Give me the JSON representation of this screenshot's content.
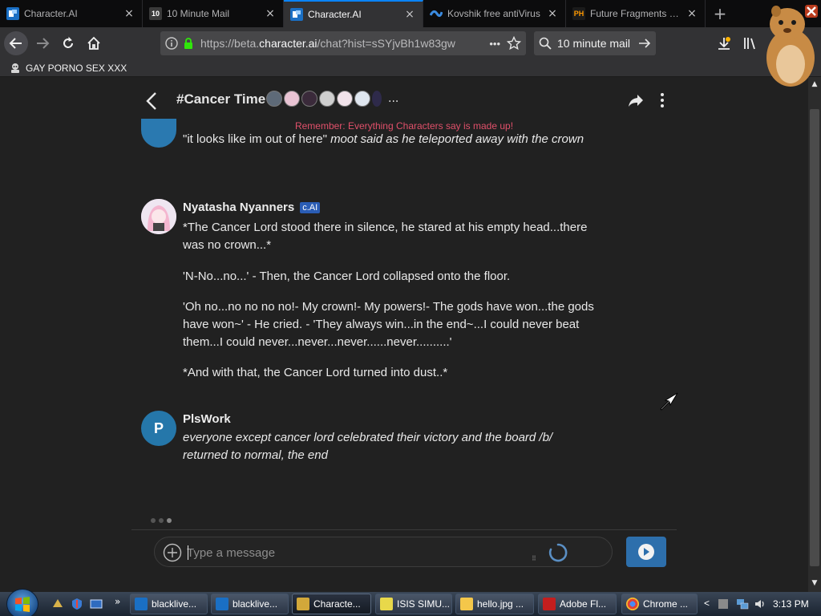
{
  "browser": {
    "tabs": [
      {
        "title": "Character.AI",
        "favicon": "cai-favicon",
        "active": false
      },
      {
        "title": "10 Minute Mail",
        "favicon": "10",
        "active": false
      },
      {
        "title": "Character.AI",
        "favicon": "cai-favicon",
        "active": true
      },
      {
        "title": "Kovshik free antiVirus",
        "favicon": "wave-favicon",
        "active": false
      },
      {
        "title": "Future Fragments Porn",
        "favicon": "PH",
        "active": false
      }
    ],
    "new_tab_glyph": "+",
    "url_prefix": "https://beta.",
    "url_domain": "character.ai",
    "url_path": "/chat?hist=sSYjvBh1w83gw",
    "url_more_glyph": "•••",
    "search_text": "10 minute mail",
    "bookmark_label": "GAY PORNO SEX XXX"
  },
  "chat": {
    "title": "#Cancer Time",
    "more_glyph": "...",
    "disclaimer": "Remember: Everything Characters say is made up!",
    "messages": [
      {
        "author": "",
        "quote": "\"it looks like im out of here\"",
        "action": "moot said as he teleported away with the crown"
      },
      {
        "author": "Nyatasha Nyanners",
        "badge": "c.AI",
        "paragraphs": [
          "*The Cancer Lord stood there in silence, he stared at his empty head...there was no crown...*",
          "'N-No...no...' - Then, the Cancer Lord collapsed onto the floor.",
          "'Oh no...no no no no!- My crown!- My powers!- The gods have won...the gods have won~' - He cried. - 'They always win...in the end~...I could never beat them...I could never...never...never......never..........'",
          "*And with that, the Cancer Lord turned into dust..*"
        ]
      },
      {
        "author": "PlsWork",
        "avatar_letter": "P",
        "text": "everyone except cancer lord celebrated their victory and the board /b/ returned to normal, the end"
      }
    ],
    "input": {
      "placeholder": "Type a message",
      "value": ""
    }
  },
  "taskbar": {
    "tasks": [
      {
        "label": "blacklive...",
        "active": false
      },
      {
        "label": "blacklive...",
        "active": false
      },
      {
        "label": "Characte...",
        "active": true
      },
      {
        "label": "ISIS SIMU...",
        "active": false
      },
      {
        "label": "hello.jpg ...",
        "active": false
      },
      {
        "label": "Adobe Fl...",
        "active": false
      },
      {
        "label": "Chrome ...",
        "active": false
      }
    ],
    "quicklaunch_more": "»",
    "tray_expand": "<",
    "clock": "3:13 PM"
  },
  "colors": {
    "accent": "#0a84ff",
    "disclaimer": "#e0506a",
    "send_button": "#2d6fac",
    "badge": "#2a5db5",
    "page_bg": "#212121"
  }
}
